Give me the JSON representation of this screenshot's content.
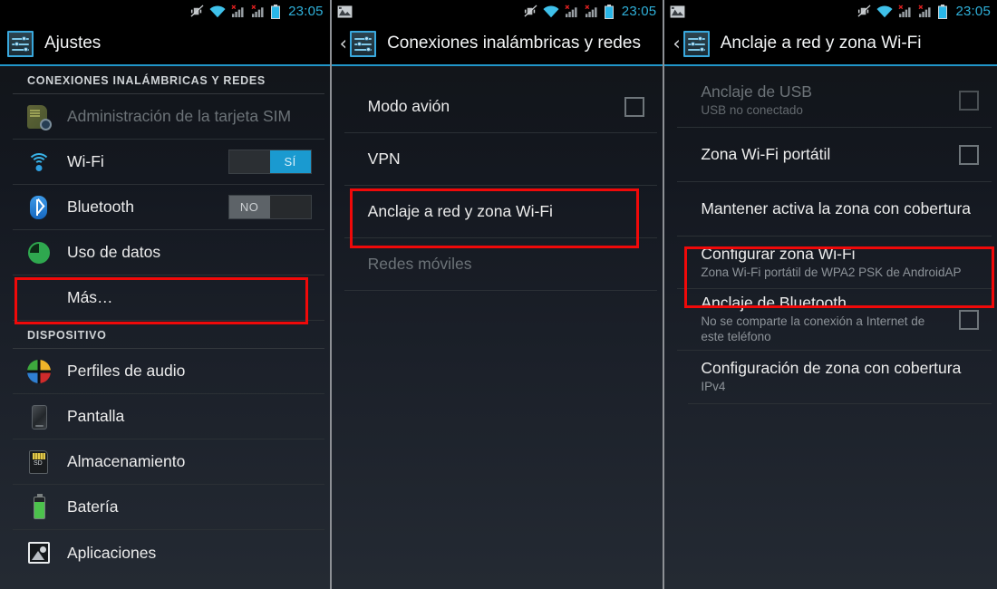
{
  "statusbar": {
    "time": "23:05",
    "icons": [
      "image-icon",
      "vibrate-off-icon",
      "wifi-icon",
      "signal-1-no-sim-icon",
      "signal-2-no-sim-icon",
      "battery-icon"
    ],
    "accent": "#2fb0d9"
  },
  "theme": {
    "accent_line": "#2196c9",
    "highlight_box": "#f00909",
    "toggle_on": "#1a9ad0",
    "toggle_off": "#5d6368"
  },
  "panel1": {
    "title": "Ajustes",
    "sections": [
      {
        "header": "CONEXIONES INALÁMBRICAS Y REDES"
      },
      {
        "header": "DISPOSITIVO"
      }
    ],
    "items": [
      {
        "label": "Administración de la tarjeta SIM",
        "icon": "sim-card-icon",
        "disabled": true
      },
      {
        "label": "Wi-Fi",
        "icon": "wifi-icon",
        "toggle": "on",
        "toggle_on_label": "SÍ",
        "toggle_off_label": ""
      },
      {
        "label": "Bluetooth",
        "icon": "bluetooth-icon",
        "toggle": "off",
        "toggle_on_label": "",
        "toggle_off_label": "NO"
      },
      {
        "label": "Uso de datos",
        "icon": "data-usage-icon"
      },
      {
        "label": "Más…",
        "icon": "none",
        "highlighted": true
      },
      {
        "label": "Perfiles de audio",
        "icon": "audio-profiles-icon"
      },
      {
        "label": "Pantalla",
        "icon": "display-icon"
      },
      {
        "label": "Almacenamiento",
        "icon": "storage-sd-icon"
      },
      {
        "label": "Batería",
        "icon": "battery-icon"
      },
      {
        "label": "Aplicaciones",
        "icon": "applications-icon"
      }
    ]
  },
  "panel2": {
    "title": "Conexiones inalámbricas y redes",
    "back": "‹",
    "items": [
      {
        "label": "Modo avión",
        "checkbox": true,
        "checked": false
      },
      {
        "label": "VPN"
      },
      {
        "label": "Anclaje a red y zona Wi-Fi",
        "highlighted": true
      },
      {
        "label": "Redes móviles",
        "disabled": true
      }
    ]
  },
  "panel3": {
    "title": "Anclaje a red y zona Wi-Fi",
    "back": "‹",
    "items": [
      {
        "label": "Anclaje de USB",
        "sub": "USB no conectado",
        "checkbox": true,
        "checked": false,
        "disabled": true
      },
      {
        "label": "Zona Wi-Fi portátil",
        "checkbox": true,
        "checked": false
      },
      {
        "label": "Mantener activa la zona con cobertura"
      },
      {
        "label": "Configurar zona Wi-Fi",
        "sub": "Zona Wi-Fi portátil de WPA2 PSK de AndroidAP",
        "highlighted": true
      },
      {
        "label": "Anclaje de Bluetooth",
        "sub": "No se comparte la conexión a Internet de este teléfono",
        "checkbox": true,
        "checked": false
      },
      {
        "label": "Configuración de zona con cobertura",
        "sub": "IPv4"
      }
    ]
  }
}
